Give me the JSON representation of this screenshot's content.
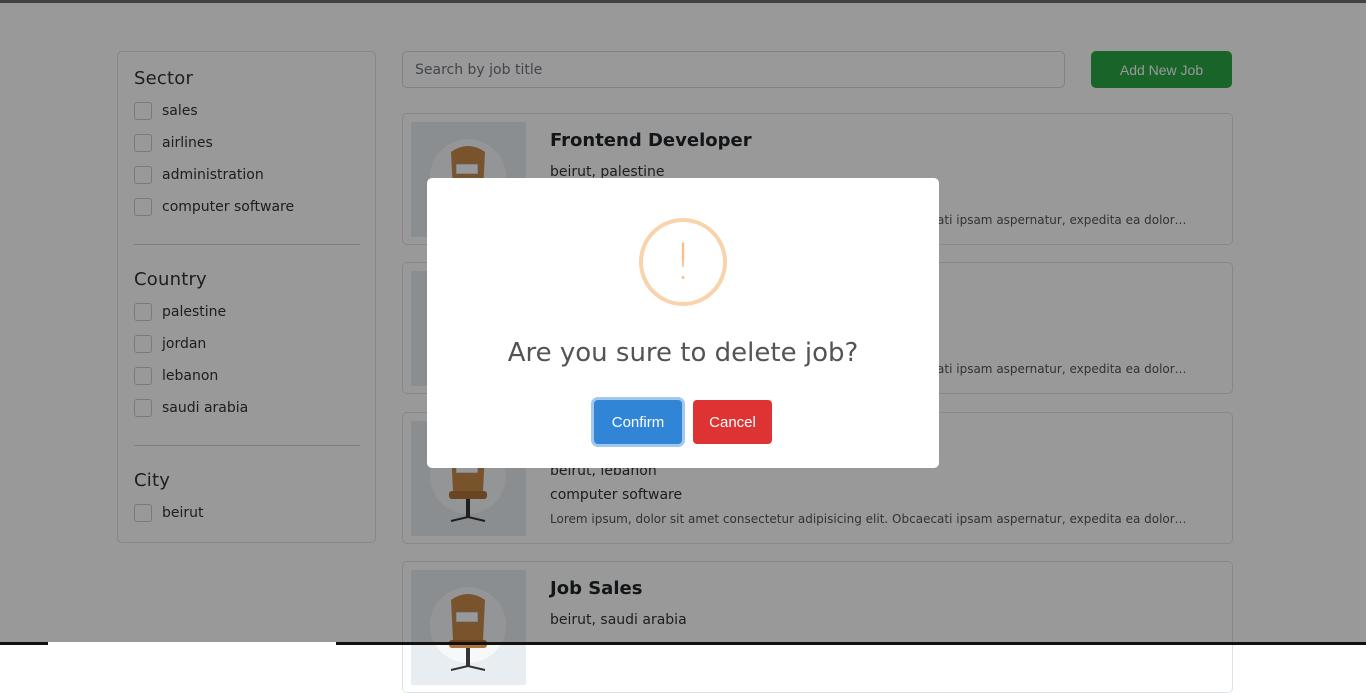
{
  "filters": {
    "sector": {
      "title": "Sector",
      "items": [
        "sales",
        "airlines",
        "administration",
        "computer software"
      ]
    },
    "country": {
      "title": "Country",
      "items": [
        "palestine",
        "jordan",
        "lebanon",
        "saudi arabia"
      ]
    },
    "city": {
      "title": "City",
      "items": [
        "beirut"
      ]
    }
  },
  "search": {
    "placeholder": "Search by job title"
  },
  "toolbar": {
    "add_label": "Add New Job"
  },
  "jobs": [
    {
      "title": "Frontend Developer",
      "location": "beirut, palestine",
      "sector": "",
      "description": "Lorem ipsum, dolor sit amet consectetur adipisicing elit. Obcaecati ipsam aspernatur, expedita ea dolores a..."
    },
    {
      "title": "",
      "location": "",
      "sector": "",
      "description": "Lorem ipsum, dolor sit amet consectetur adipisicing elit. Obcaecati ipsam aspernatur, expedita ea dolores a..."
    },
    {
      "title": "",
      "location": "beirut, lebanon",
      "sector": "computer software",
      "description": "Lorem ipsum, dolor sit amet consectetur adipisicing elit. Obcaecati ipsam aspernatur, expedita ea dolores a..."
    },
    {
      "title": "Job Sales",
      "location": "beirut, saudi arabia",
      "sector": "",
      "description": ""
    }
  ],
  "modal": {
    "icon": "!",
    "title": "Are you sure to delete job?",
    "confirm_label": "Confirm",
    "cancel_label": "Cancel",
    "colors": {
      "confirm": "#3085d6",
      "cancel": "#dd3333",
      "warning": "#f8bb86"
    }
  }
}
